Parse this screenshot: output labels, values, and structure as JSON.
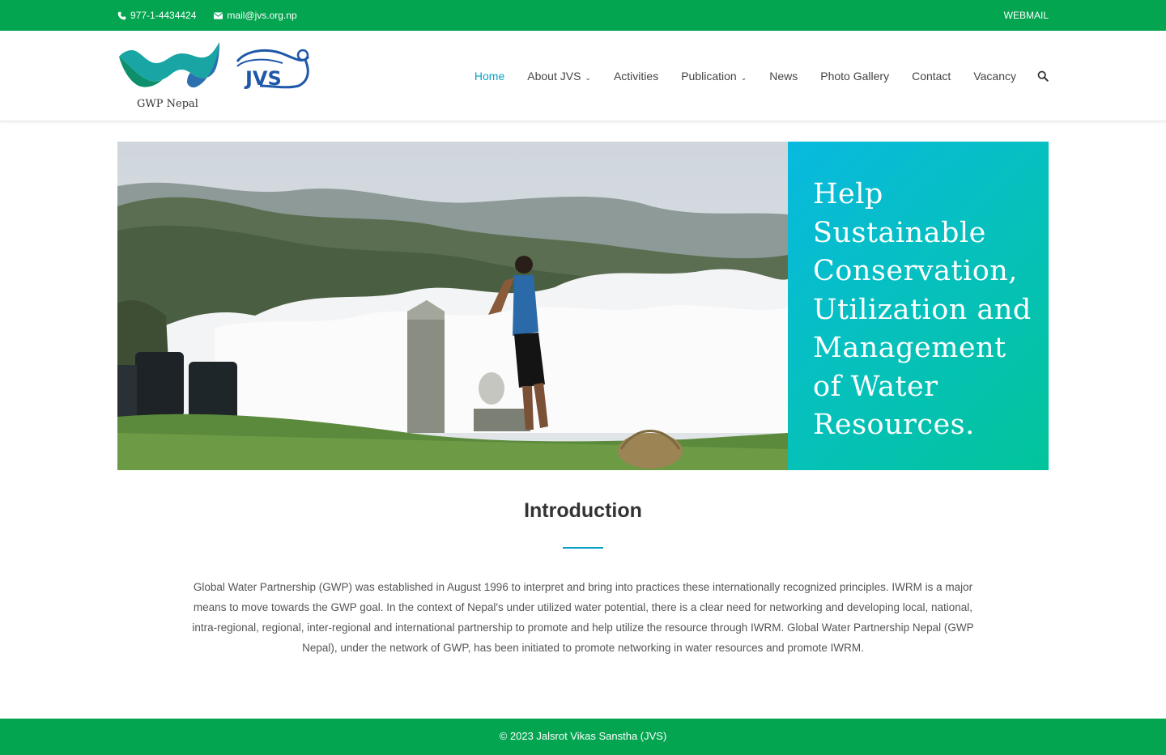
{
  "topbar": {
    "phone": "977-1-4434424",
    "email": "mail@jvs.org.np",
    "webmail": "WEBMAIL",
    "phone_icon": "phone-icon",
    "email_icon": "envelope-icon"
  },
  "logo": {
    "gwp_caption": "GWP Nepal",
    "jvs_text": "JVS"
  },
  "nav": {
    "items": [
      {
        "label": "Home",
        "active": true
      },
      {
        "label": "About JVS",
        "dropdown": true
      },
      {
        "label": "Activities"
      },
      {
        "label": "Publication",
        "dropdown": true
      },
      {
        "label": "News"
      },
      {
        "label": "Photo Gallery"
      },
      {
        "label": "Contact"
      },
      {
        "label": "Vacancy"
      }
    ],
    "caret": "⌄",
    "search_icon": "search-icon"
  },
  "hero": {
    "tagline": "Help Sustainable Conservation, Utilization and Management of Water Resources."
  },
  "intro": {
    "title": "Introduction",
    "text": "Global Water Partnership (GWP) was established in August 1996 to interpret and bring into practices these internationally recognized principles. IWRM is a major means to move towards the GWP goal. In the context of Nepal's under utilized water potential, there is a clear need for networking and developing local, national, intra-regional, regional, inter-regional and international partnership to promote and help utilize the resource through IWRM. Global Water Partnership Nepal (GWP Nepal), under the network of GWP, has been initiated to promote networking in water resources and promote IWRM."
  },
  "footer": {
    "copyright": "© 2023 Jalsrot Vikas Sanstha (JVS)"
  },
  "colors": {
    "brand_green": "#04a550",
    "accent_blue": "#0aa0c8",
    "panel_teal": "#06c0c0"
  }
}
